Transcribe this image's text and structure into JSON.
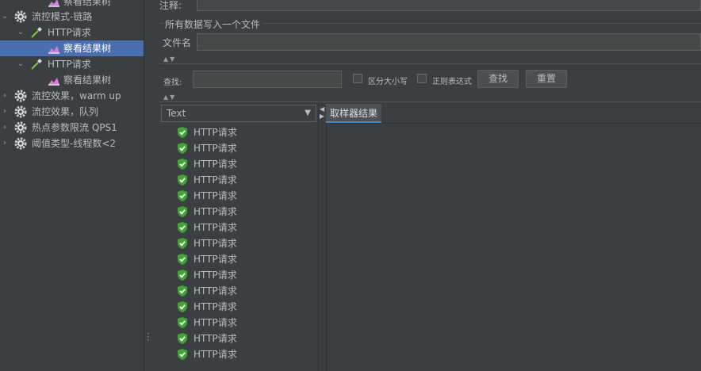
{
  "tree": {
    "items": [
      {
        "label": "察看结果树",
        "toggle": "",
        "icon": "result-tree-icon"
      },
      {
        "label": "流控模式-链路",
        "toggle": "⌄",
        "icon": "thread-group-gear-icon"
      },
      {
        "label": "HTTP请求",
        "toggle": "⌄",
        "icon": "http-sampler-pipette-icon"
      },
      {
        "label": "察看结果树",
        "toggle": "",
        "icon": "result-tree-icon"
      },
      {
        "label": "HTTP请求",
        "toggle": "⌄",
        "icon": "http-sampler-pipette-icon"
      },
      {
        "label": "察看结果树",
        "toggle": "",
        "icon": "result-tree-icon"
      },
      {
        "label": "流控效果，warm up",
        "toggle": "›",
        "icon": "thread-group-gear-icon"
      },
      {
        "label": "流控效果，队列",
        "toggle": "›",
        "icon": "thread-group-gear-icon"
      },
      {
        "label": "热点参数限流 QPS1",
        "toggle": "›",
        "icon": "thread-group-gear-icon"
      },
      {
        "label": "阈值类型-线程数<2",
        "toggle": "›",
        "icon": "thread-group-gear-icon"
      }
    ]
  },
  "form": {
    "comment_label": "注释:",
    "section_title": "所有数据写入一个文件",
    "filename_label": "文件名"
  },
  "search": {
    "label": "查找:",
    "case_label": "区分大小写",
    "regex_label": "正则表达式",
    "find_button": "查找",
    "reset_button": "重置"
  },
  "renderer": {
    "selected": "Text"
  },
  "results": {
    "items": [
      "HTTP请求",
      "HTTP请求",
      "HTTP请求",
      "HTTP请求",
      "HTTP请求",
      "HTTP请求",
      "HTTP请求",
      "HTTP请求",
      "HTTP请求",
      "HTTP请求",
      "HTTP请求",
      "HTTP请求",
      "HTTP请求",
      "HTTP请求",
      "HTTP请求"
    ]
  },
  "tabs": {
    "sampler_result": "取样器结果"
  },
  "colors": {
    "background": "#3c3f41",
    "selection": "#4b6eaf",
    "success_shield": "#3fa535"
  }
}
